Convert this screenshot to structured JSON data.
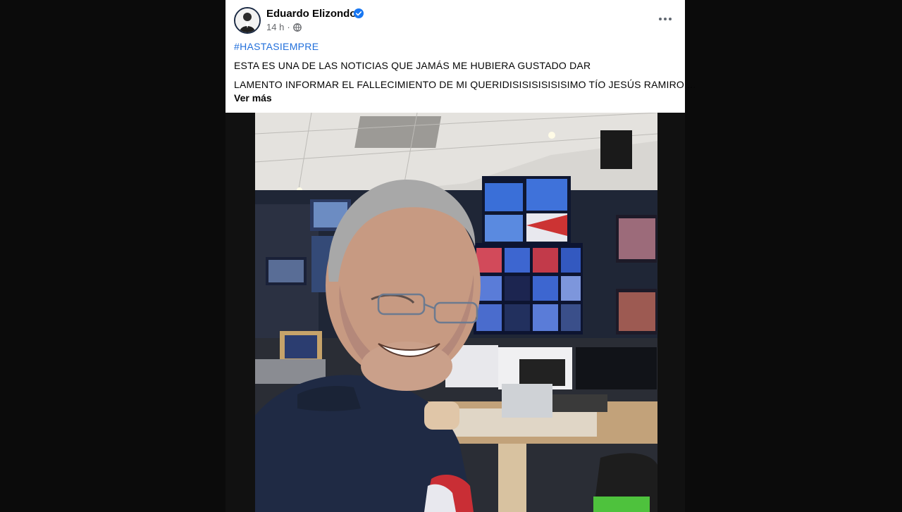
{
  "post": {
    "author": "Eduardo Elizondo",
    "time": "14 h",
    "separator": "·",
    "hashtag": "#HASTASIEMPRE",
    "line1": "ESTA ES UNA DE LAS NOTICIAS QUE JAMÁS ME HUBIERA GUSTADO DAR",
    "line2": "LAMENTO INFORMAR EL FALLECIMIENTO DE MI QUERIDISISISISISISIMO TÍO JESÚS RAMIRO ...",
    "see_more": "Ver más"
  },
  "icons": {
    "verified": "verified-badge-icon",
    "audience": "globe-icon",
    "options": "more-options-icon"
  },
  "colors": {
    "link": "#216fdb",
    "verified": "#1877f2",
    "meta": "#65676b"
  }
}
